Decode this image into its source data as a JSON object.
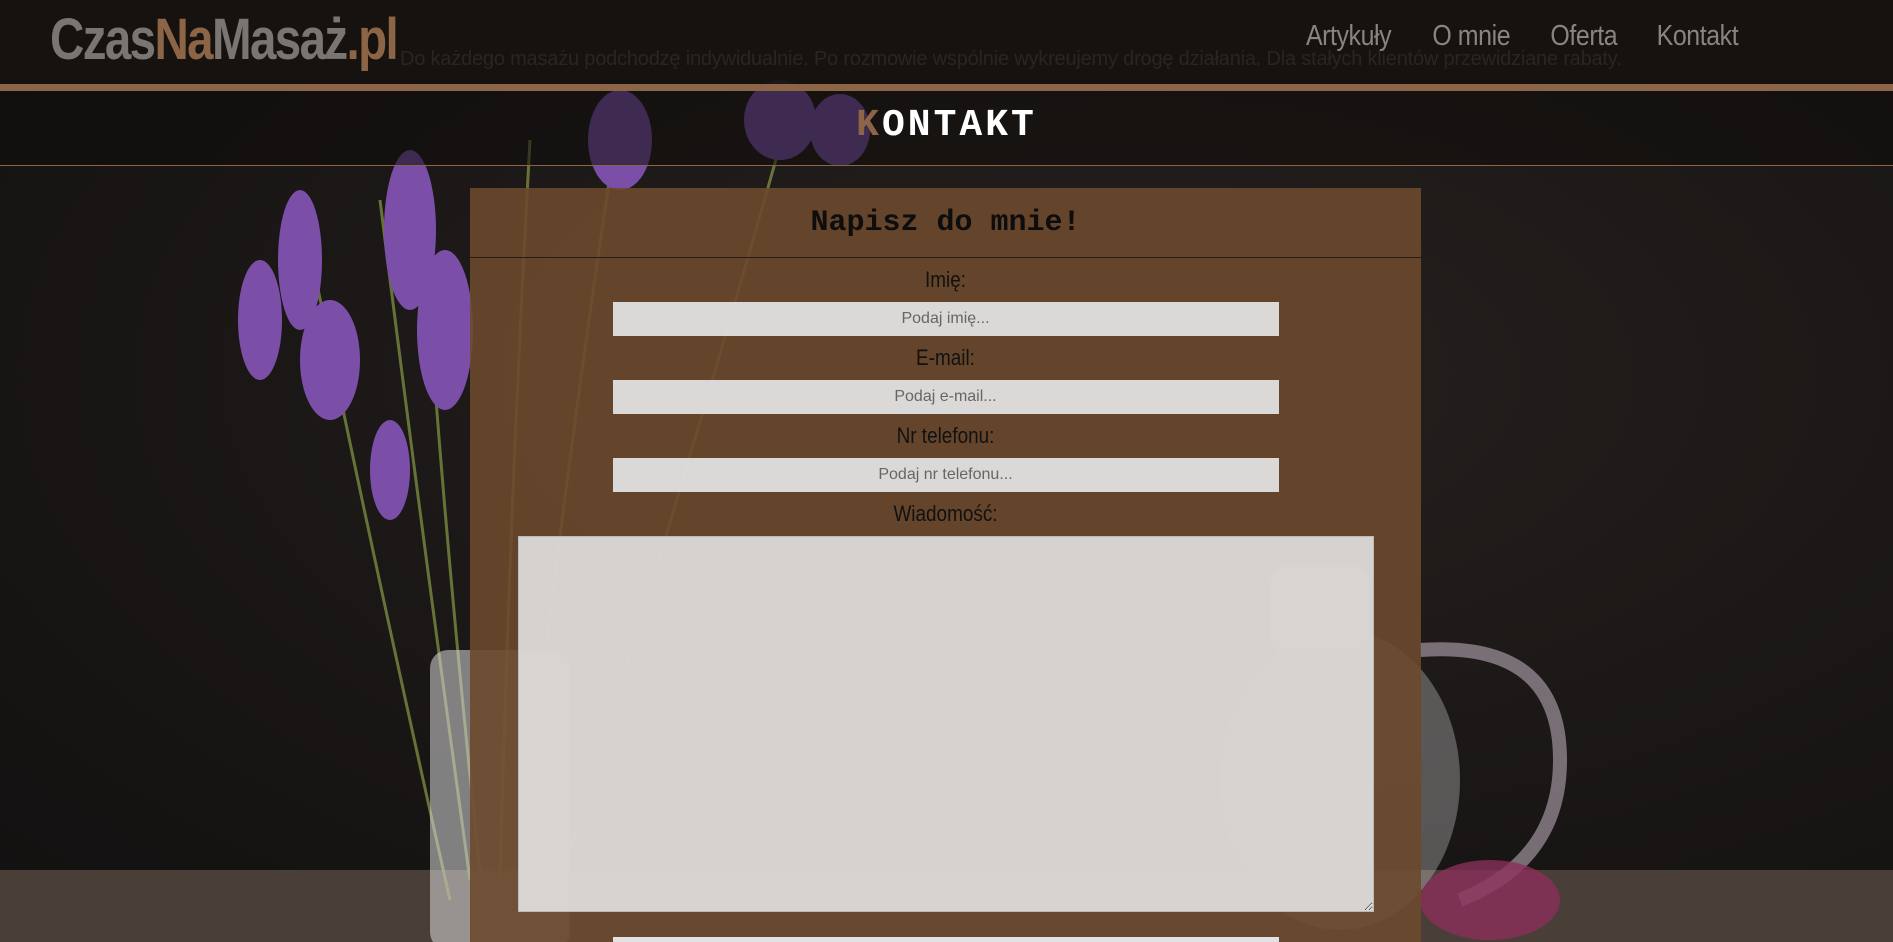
{
  "site": {
    "logo_part1": "Czas",
    "logo_part2": "Na",
    "logo_part3": "Masaż",
    "logo_part4": ".pl",
    "nav": [
      {
        "label": "Artykuły"
      },
      {
        "label": "O mnie"
      },
      {
        "label": "Oferta"
      },
      {
        "label": "Kontakt"
      }
    ],
    "ghost_text": "Do każdego masażu podchodzę indywidualnie. Po rozmowie wspólnie wykreujemy drogę działania. Dla stałych klientów przewidziane rabaty."
  },
  "section": {
    "title_first": "K",
    "title_rest": "ONTAKT"
  },
  "form": {
    "title": "Napisz do mnie!",
    "name_label": "Imię:",
    "name_placeholder": "Podaj imię...",
    "email_label": "E-mail:",
    "email_placeholder": "Podaj e-mail...",
    "phone_label": "Nr telefonu:",
    "phone_placeholder": "Podaj nr telefonu...",
    "message_label": "Wiadomość:"
  },
  "colors": {
    "accent": "#8c6446",
    "card": "#6b492e",
    "lavender": "#7b4fa8"
  }
}
